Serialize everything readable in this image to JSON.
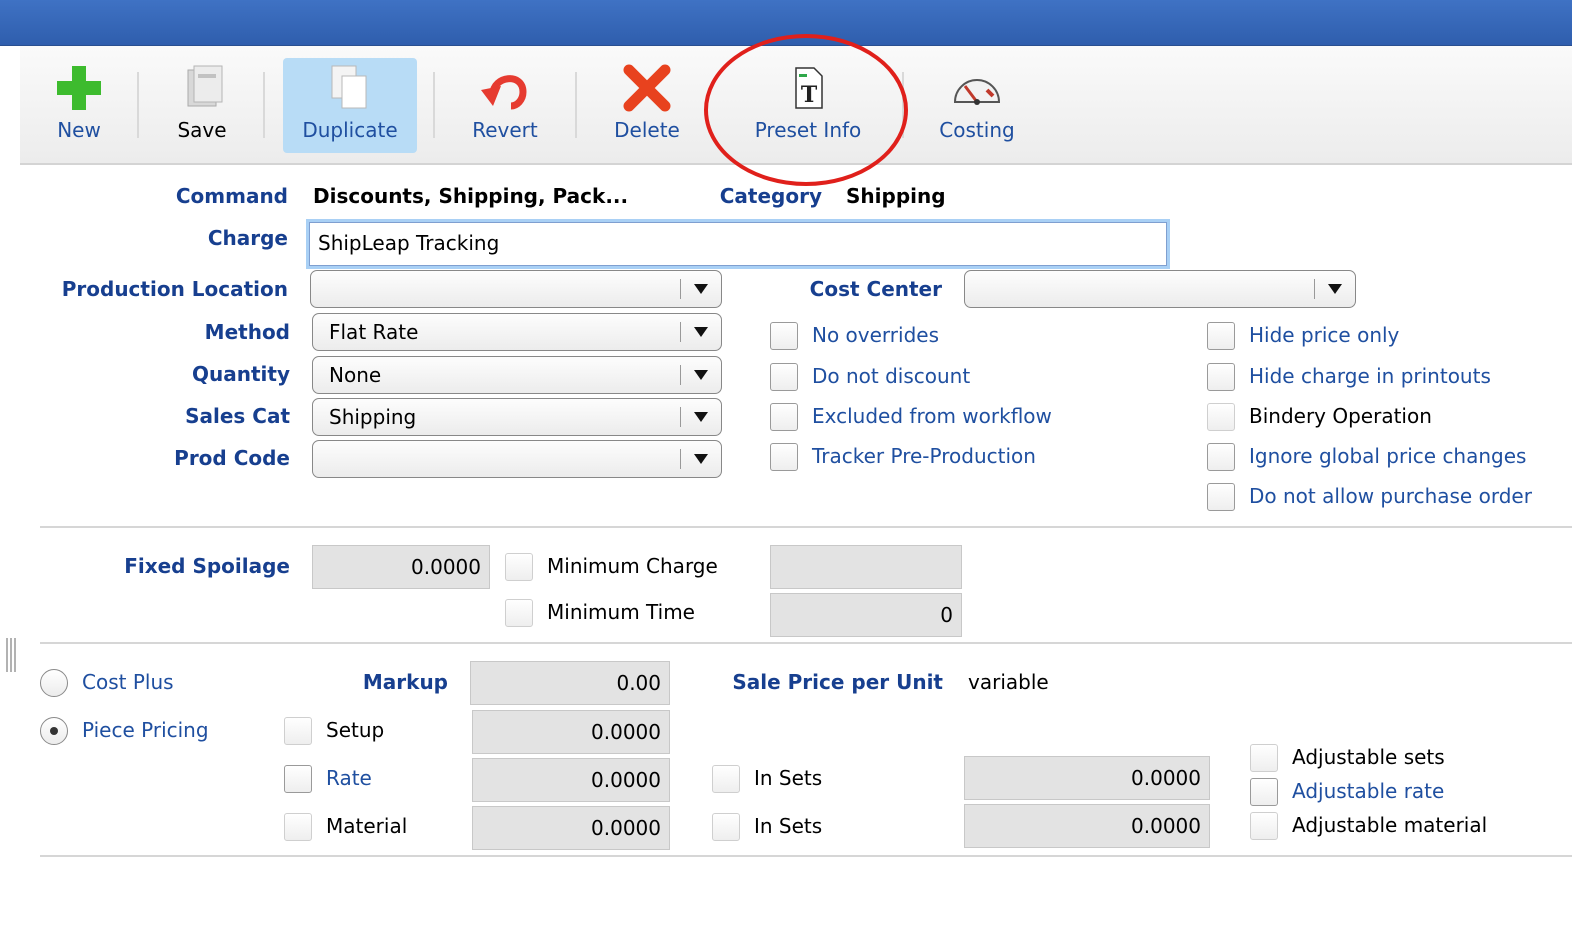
{
  "toolbar": {
    "new": "New",
    "save": "Save",
    "duplicate": "Duplicate",
    "revert": "Revert",
    "delete": "Delete",
    "preset_info": "Preset Info",
    "costing": "Costing"
  },
  "form": {
    "command_label": "Command",
    "command_value": "Discounts, Shipping, Pack...",
    "category_label": "Category",
    "category_value": "Shipping",
    "charge_label": "Charge",
    "charge_value": "ShipLeap Tracking",
    "production_location_label": "Production Location",
    "production_location_value": "",
    "method_label": "Method",
    "method_value": "Flat Rate",
    "quantity_label": "Quantity",
    "quantity_value": "None",
    "sales_cat_label": "Sales Cat",
    "sales_cat_value": "Shipping",
    "prod_code_label": "Prod Code",
    "prod_code_value": "",
    "cost_center_label": "Cost Center",
    "cost_center_value": ""
  },
  "options": {
    "no_overrides": "No overrides",
    "do_not_discount": "Do not discount",
    "excluded_from_workflow": "Excluded from workflow",
    "tracker_pre_production": "Tracker Pre-Production",
    "hide_price_only": "Hide price only",
    "hide_charge_in_printouts": "Hide charge in printouts",
    "bindery_operation": "Bindery Operation",
    "ignore_global_price_changes": "Ignore global price changes",
    "do_not_allow_purchase_order": "Do not allow purchase order"
  },
  "spoilage": {
    "fixed_spoilage_label": "Fixed Spoilage",
    "fixed_spoilage_value": "0.0000",
    "minimum_charge_label": "Minimum Charge",
    "minimum_charge_value": "",
    "minimum_time_label": "Minimum Time",
    "minimum_time_value": "0"
  },
  "pricing": {
    "cost_plus_label": "Cost Plus",
    "piece_pricing_label": "Piece Pricing",
    "selected": "Piece Pricing",
    "markup_label": "Markup",
    "markup_value": "0.00",
    "sale_price_label": "Sale Price per Unit",
    "sale_price_value": "variable",
    "setup_label": "Setup",
    "setup_value": "0.0000",
    "rate_label": "Rate",
    "rate_value": "0.0000",
    "material_label": "Material",
    "material_value": "0.0000",
    "in_sets_1_label": "In Sets",
    "in_sets_1_value": "0.0000",
    "in_sets_2_label": "In Sets",
    "in_sets_2_value": "0.0000",
    "adjustable_sets": "Adjustable sets",
    "adjustable_rate": "Adjustable rate",
    "adjustable_material": "Adjustable material"
  },
  "colors": {
    "label_blue": "#173f8f",
    "link_blue": "#1f4fa0",
    "annotation_red": "#e0201b",
    "active_button": "#b8dcf6"
  },
  "icons": [
    "plus-icon",
    "save-icon",
    "duplicate-icon",
    "revert-icon",
    "delete-icon",
    "preset-info-icon",
    "costing-icon",
    "splitter-grip-icon"
  ]
}
